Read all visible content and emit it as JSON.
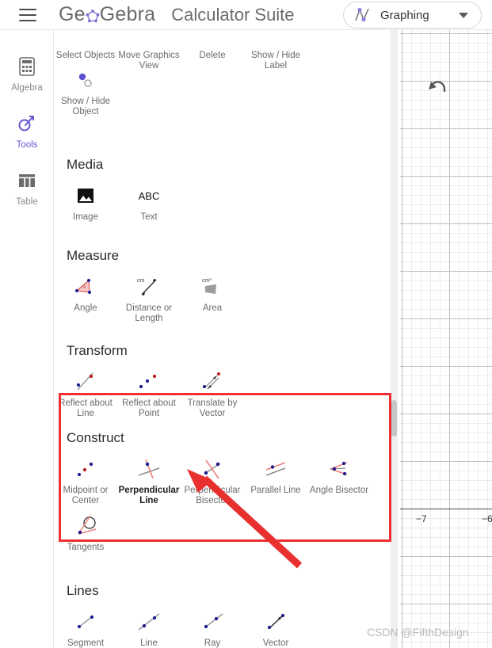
{
  "header": {
    "menu_icon": "hamburger-icon",
    "brand": {
      "pre": "Ge",
      "o": "o",
      "post": "Gebra"
    },
    "suite_title": "Calculator Suite",
    "app_switcher": {
      "icon": "graphing-curve-icon",
      "label": "Graphing",
      "caret": "chevron-down-icon"
    }
  },
  "rail": {
    "items": [
      {
        "label": "Algebra",
        "icon": "calculator-icon",
        "active": false
      },
      {
        "label": "Tools",
        "icon": "tools-icon",
        "active": true
      },
      {
        "label": "Table",
        "icon": "table-icon",
        "active": false
      }
    ]
  },
  "panel": {
    "clipped_top_row": [
      {
        "label": "Select Objects",
        "icon": "select-objects-icon"
      },
      {
        "label": "Move Graphics View",
        "icon": "move-graphics-view-icon"
      },
      {
        "label": "Delete",
        "icon": "delete-icon"
      },
      {
        "label": "Show / Hide Label",
        "icon": "show-hide-label-icon"
      }
    ],
    "show_hide_object": {
      "label": "Show / Hide Object",
      "icon": "show-hide-object-icon"
    },
    "sections": [
      {
        "title": "Media",
        "tools": [
          {
            "label": "Image",
            "icon": "image-icon"
          },
          {
            "label": "Text",
            "icon": "text-abc-icon"
          }
        ]
      },
      {
        "title": "Measure",
        "tools": [
          {
            "label": "Angle",
            "icon": "angle-icon"
          },
          {
            "label": "Distance or Length",
            "icon": "distance-length-icon"
          },
          {
            "label": "Area",
            "icon": "area-icon"
          }
        ]
      },
      {
        "title": "Transform",
        "tools": [
          {
            "label": "Reflect about Line",
            "icon": "reflect-about-line-icon"
          },
          {
            "label": "Reflect about Point",
            "icon": "reflect-about-point-icon"
          },
          {
            "label": "Translate by Vector",
            "icon": "translate-by-vector-icon"
          }
        ]
      },
      {
        "title": "Construct",
        "highlighted": true,
        "tools": [
          {
            "label": "Midpoint or Center",
            "icon": "midpoint-center-icon"
          },
          {
            "label": "Perpendicular Line",
            "icon": "perpendicular-line-icon",
            "selected": true
          },
          {
            "label": "Perpendicular Bisector",
            "icon": "perpendicular-bisector-icon"
          },
          {
            "label": "Parallel Line",
            "icon": "parallel-line-icon"
          },
          {
            "label": "Angle Bisector",
            "icon": "angle-bisector-icon"
          },
          {
            "label": "Tangents",
            "icon": "tangents-icon"
          }
        ]
      },
      {
        "title": "Lines",
        "tools": [
          {
            "label": "Segment",
            "icon": "segment-icon"
          },
          {
            "label": "Line",
            "icon": "line-icon"
          },
          {
            "label": "Ray",
            "icon": "ray-icon"
          },
          {
            "label": "Vector",
            "icon": "vector-icon"
          }
        ]
      }
    ]
  },
  "graph": {
    "undo_icon": "undo-icon",
    "x_ticks": [
      "−7",
      "−6"
    ]
  },
  "annotation": {
    "box_color": "#ef2f31",
    "arrow_color": "#e8312f",
    "arrow_target": "Perpendicular Line"
  },
  "watermark": "CSDN @FifthDesign",
  "colors": {
    "accent_purple": "#6557d2",
    "tool_gray": "#6b6b6b",
    "annotation_red": "#ef2f31"
  }
}
